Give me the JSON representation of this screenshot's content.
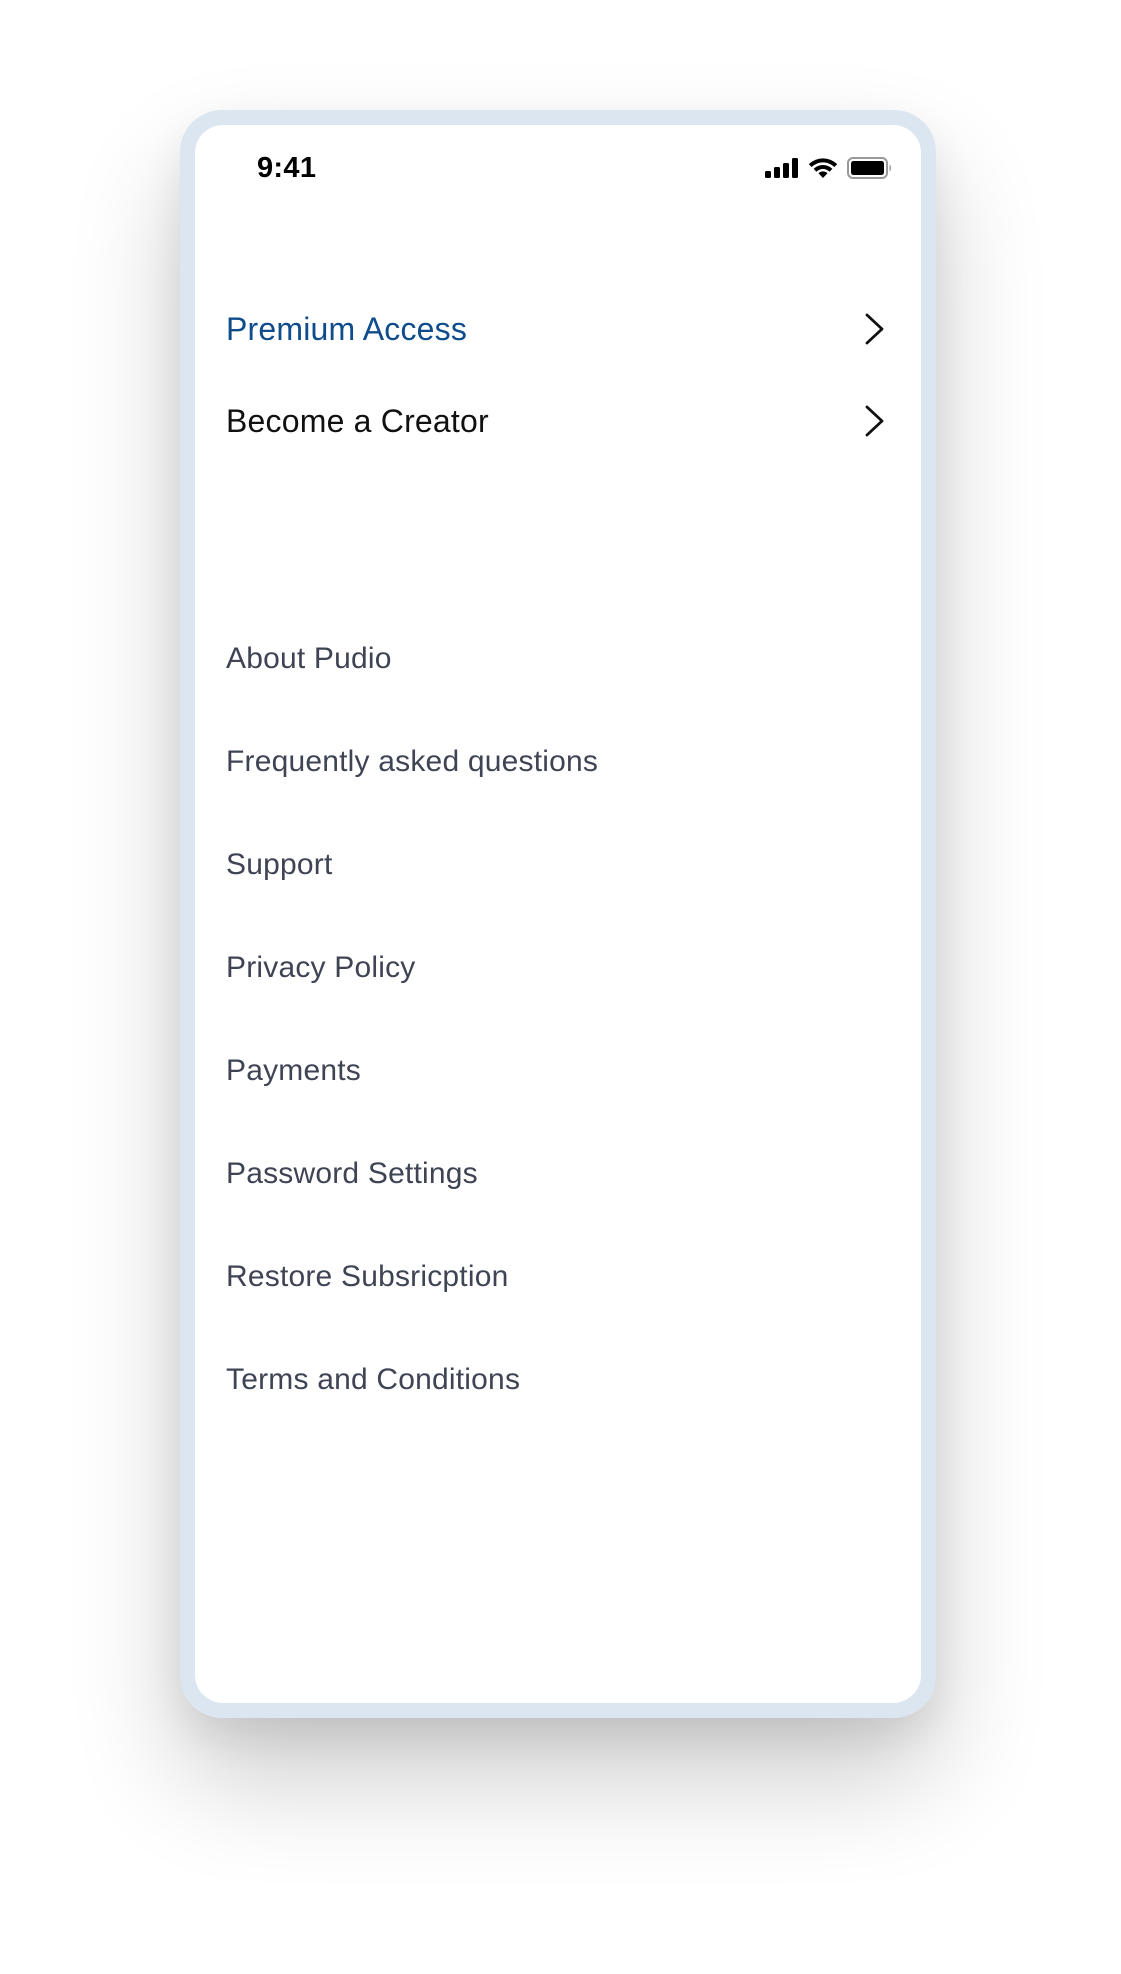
{
  "status_bar": {
    "time": "9:41",
    "icons": [
      "cellular-signal-icon",
      "wifi-icon",
      "battery-icon"
    ]
  },
  "colors": {
    "accent": "#0f4c8c",
    "primary_text": "#111111",
    "secondary_text": "#3f4455",
    "frame": "#dbe6f1"
  },
  "menu": {
    "primary": [
      {
        "label": "Premium Access",
        "icon": "chevron-right-icon",
        "highlighted": true
      },
      {
        "label": "Become a Creator",
        "icon": "chevron-right-icon",
        "highlighted": false
      }
    ],
    "secondary": [
      {
        "label": "About Pudio"
      },
      {
        "label": "Frequently asked questions"
      },
      {
        "label": "Support"
      },
      {
        "label": "Privacy Policy"
      },
      {
        "label": "Payments"
      },
      {
        "label": "Password Settings"
      },
      {
        "label": "Restore Subsricption"
      },
      {
        "label": "Terms and Conditions"
      }
    ]
  }
}
